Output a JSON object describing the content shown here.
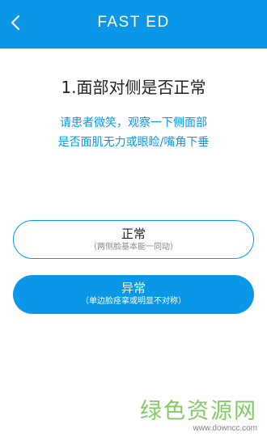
{
  "app_bar": {
    "title": "FAST ED",
    "back_icon": "chevron-left-icon",
    "color": "#0a97e8"
  },
  "question": {
    "title": "1.面部对侧是否正常",
    "instruction_lines": [
      "请患者微笑，观察一下侧面部",
      "是否面肌无力或眼睑/嘴角下垂"
    ]
  },
  "options": {
    "normal": {
      "label": "正常",
      "description": "（两侧脸基本能一同动）"
    },
    "abnormal": {
      "label": "异常",
      "description": "（单边脸痉挛或明显不对称）"
    }
  },
  "colors": {
    "accent": "#0a97e8",
    "text_primary": "#222222",
    "text_muted": "#8a8a8a",
    "watermark": "#6cc14a"
  },
  "watermark": {
    "text": "绿色资源网",
    "url": "www.downcc.com"
  }
}
